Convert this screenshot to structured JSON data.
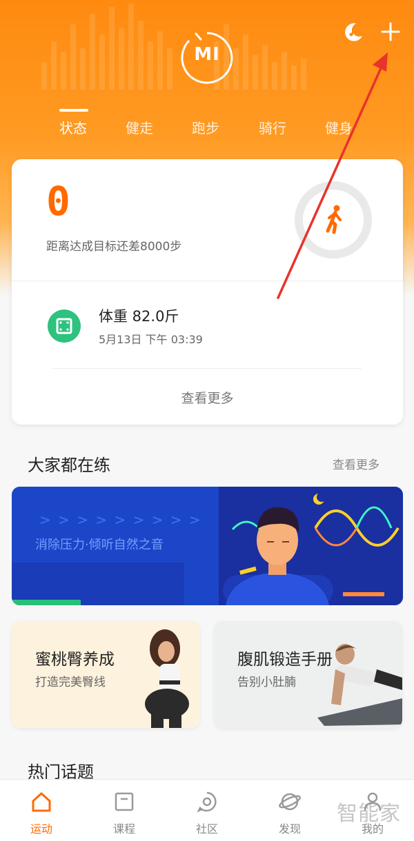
{
  "header": {
    "logo": "MI",
    "tabs": [
      {
        "label": "状态",
        "active": true
      },
      {
        "label": "健走",
        "active": false
      },
      {
        "label": "跑步",
        "active": false
      },
      {
        "label": "骑行",
        "active": false
      },
      {
        "label": "健身",
        "active": false
      }
    ],
    "icons": [
      "moon-music-icon",
      "plus-icon"
    ]
  },
  "status_card": {
    "steps": "0",
    "goal_text": "距离达成目标还差8000步",
    "weight_title": "体重 82.0斤",
    "weight_time": "5月13日 下午 03:39",
    "see_more": "查看更多"
  },
  "practice_section": {
    "title": "大家都在练",
    "more": "查看更多",
    "banner_text": "消除压力·倾听自然之音",
    "cards": [
      {
        "title": "蜜桃臀养成",
        "subtitle": "打造完美臀线"
      },
      {
        "title": "腹肌锻造手册",
        "subtitle": "告别小肚腩"
      }
    ]
  },
  "hot_topics": {
    "title": "热门话题"
  },
  "bottom_nav": [
    {
      "label": "运动",
      "icon": "home-icon",
      "active": true
    },
    {
      "label": "课程",
      "icon": "course-icon",
      "active": false
    },
    {
      "label": "社区",
      "icon": "community-icon",
      "active": false
    },
    {
      "label": "发现",
      "icon": "discover-icon",
      "active": false
    },
    {
      "label": "我的",
      "icon": "profile-icon",
      "active": false
    }
  ],
  "watermark": "智能家",
  "colors": {
    "accent": "#ff6a00",
    "header_orange": "#ff8a10",
    "weight_green": "#2ec27e",
    "annotation_red": "#e8332a"
  }
}
